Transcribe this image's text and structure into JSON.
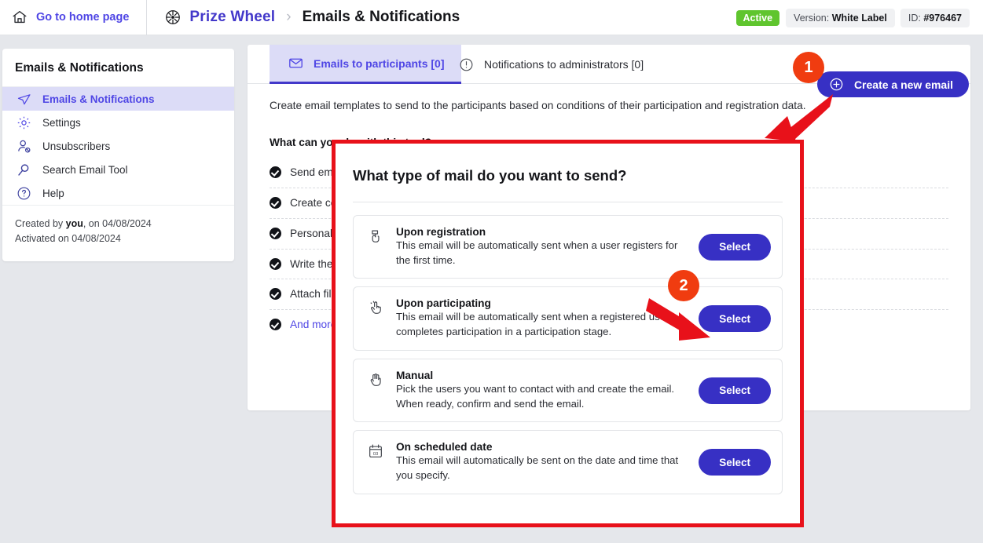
{
  "topbar": {
    "home_label": "Go to home page",
    "home_icon": "house-icon",
    "app_icon": "prize-wheel-icon",
    "app_name": "Prize Wheel",
    "separator": "›",
    "page_title": "Emails & Notifications",
    "status_badge": "Active",
    "version_label": "Version:",
    "version_value": "White Label",
    "id_label": "ID:",
    "id_value": "#976467"
  },
  "sidebar": {
    "title": "Emails & Notifications",
    "items": [
      {
        "label": "Emails & Notifications",
        "icon": "paper-plane-icon",
        "active": true
      },
      {
        "label": "Settings",
        "icon": "gear-icon",
        "active": false
      },
      {
        "label": "Unsubscribers",
        "icon": "user-block-icon",
        "active": false
      },
      {
        "label": "Search Email Tool",
        "icon": "magnifier-icon",
        "active": false
      },
      {
        "label": "Help",
        "icon": "question-circle-icon",
        "active": false
      }
    ],
    "footer": {
      "created_prefix": "Created by ",
      "created_by": "you",
      "created_suffix": ", on 04/08/2024",
      "activated": "Activated on 04/08/2024"
    }
  },
  "main": {
    "tabs": [
      {
        "label": "Emails to participants [0]",
        "icon": "envelope-icon",
        "active": true
      },
      {
        "label": "Notifications to administrators [0]",
        "icon": "alert-circle-icon",
        "active": false
      }
    ],
    "create_button": {
      "label": "Create a new email",
      "icon": "plus-circle-icon"
    },
    "intro": "Create email templates to send to the participants based on conditions of their participation and registration data.",
    "subhead": "What can you do with this tool?",
    "features": [
      "Send emails automatically when a user registers or participates.",
      "Create conditions based on the results of the participants (points, prizes, number of entries...).",
      "Personalize the content of the email for each participant.",
      "Write the email in several languages depending on the language of each participant.",
      "Attach files and images to the emails you send.",
      "And more..."
    ],
    "last_feature_is_link": true
  },
  "modal": {
    "title": "What type of mail do you want to send?",
    "options": [
      {
        "title": "Upon registration",
        "description": "This email will be automatically sent when a user registers for the first time.",
        "icon": "registration-hand-icon",
        "button": "Select"
      },
      {
        "title": "Upon participating",
        "description": "This email will be automatically sent when a registered user completes participation in a participation stage.",
        "icon": "tap-hand-icon",
        "button": "Select"
      },
      {
        "title": "Manual",
        "description": "Pick the users you want to contact with and create the email. When ready, confirm and send the email.",
        "icon": "open-hand-icon",
        "button": "Select"
      },
      {
        "title": "On scheduled date",
        "description": "This email will automatically be sent on the date and time that you specify.",
        "icon": "calendar-icon",
        "button": "Select"
      }
    ]
  },
  "annotations": {
    "badges": [
      {
        "number": "1",
        "target": "create-a-new-email-button"
      },
      {
        "number": "2",
        "target": "select-button-upon-participating"
      }
    ],
    "highlight_color": "#e8111a",
    "badge_color": "#f03c10"
  },
  "colors": {
    "primary": "#3730c4",
    "accent": "#4f46e5",
    "active_green": "#5fc52e",
    "annotation_red": "#e8111a",
    "badge_orange": "#f03c10",
    "page_bg": "#e5e7eb"
  }
}
